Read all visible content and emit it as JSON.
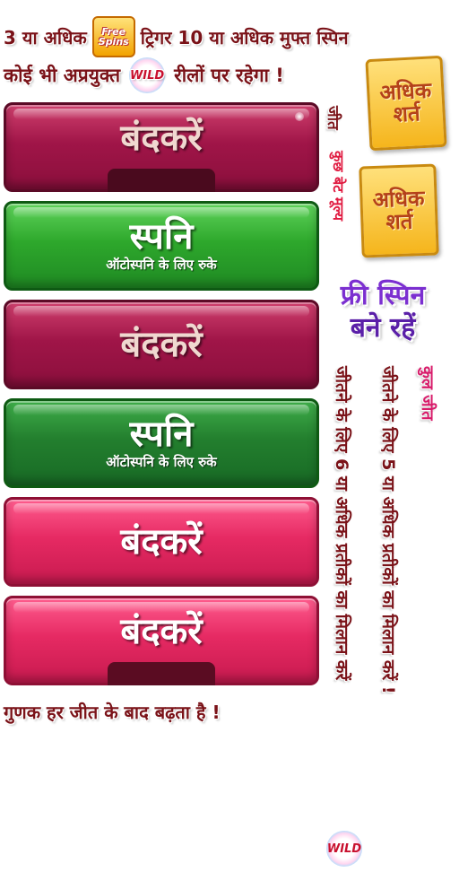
{
  "top": {
    "line1_pre": "3 या अधिक",
    "line1_post": "ट्रिगर 10 या अधिक मुफ्त स्पिन",
    "line2_pre": "कोई भी अप्रयुक्त",
    "line2_post": "रीलों पर रहेगा !",
    "free_badge_l1": "Free",
    "free_badge_l2": "Spins",
    "wild_badge": "WILD"
  },
  "buttons": [
    {
      "label": "बंदकरें",
      "style": "red",
      "sublabel": ""
    },
    {
      "label": "स्पनि",
      "style": "green",
      "sublabel": "ऑटोस्पनि के लिए रुके"
    },
    {
      "label": "बंदकरें",
      "style": "red",
      "sublabel": ""
    },
    {
      "label": "स्पनि",
      "style": "green-dim",
      "sublabel": "ऑटोस्पनि के लिए रुके"
    },
    {
      "label": "बंदकरें",
      "style": "pink",
      "sublabel": ""
    },
    {
      "label": "बंदकरें",
      "style": "pink",
      "sublabel": ""
    }
  ],
  "side": {
    "chip1": "अधिक शर्त",
    "chip2": "अधिक शर्त",
    "vertical_red": "कुछ बेट मूल्य",
    "vertical_dark": "जीत",
    "free_spin_l1": "फ्री स्पिन",
    "free_spin_l2": "बने रहें",
    "vertical_pink": "कुल जीत",
    "vertical_win5": "जीतने के लिए 5 या अधिक प्रतीकों का मिलान करें !",
    "vertical_win6": "जीतने के लिए 6 या अधिक प्रतीकों का मिलान करें",
    "wild_bottom": "WILD"
  },
  "bottom": {
    "multiplier": "गुणक हर जीत के बाद बढ़ता है !"
  },
  "colors": {
    "text_dark": "#7a1218",
    "accent_purple": "#6a1fb0",
    "accent_pink": "#d81b6a"
  }
}
